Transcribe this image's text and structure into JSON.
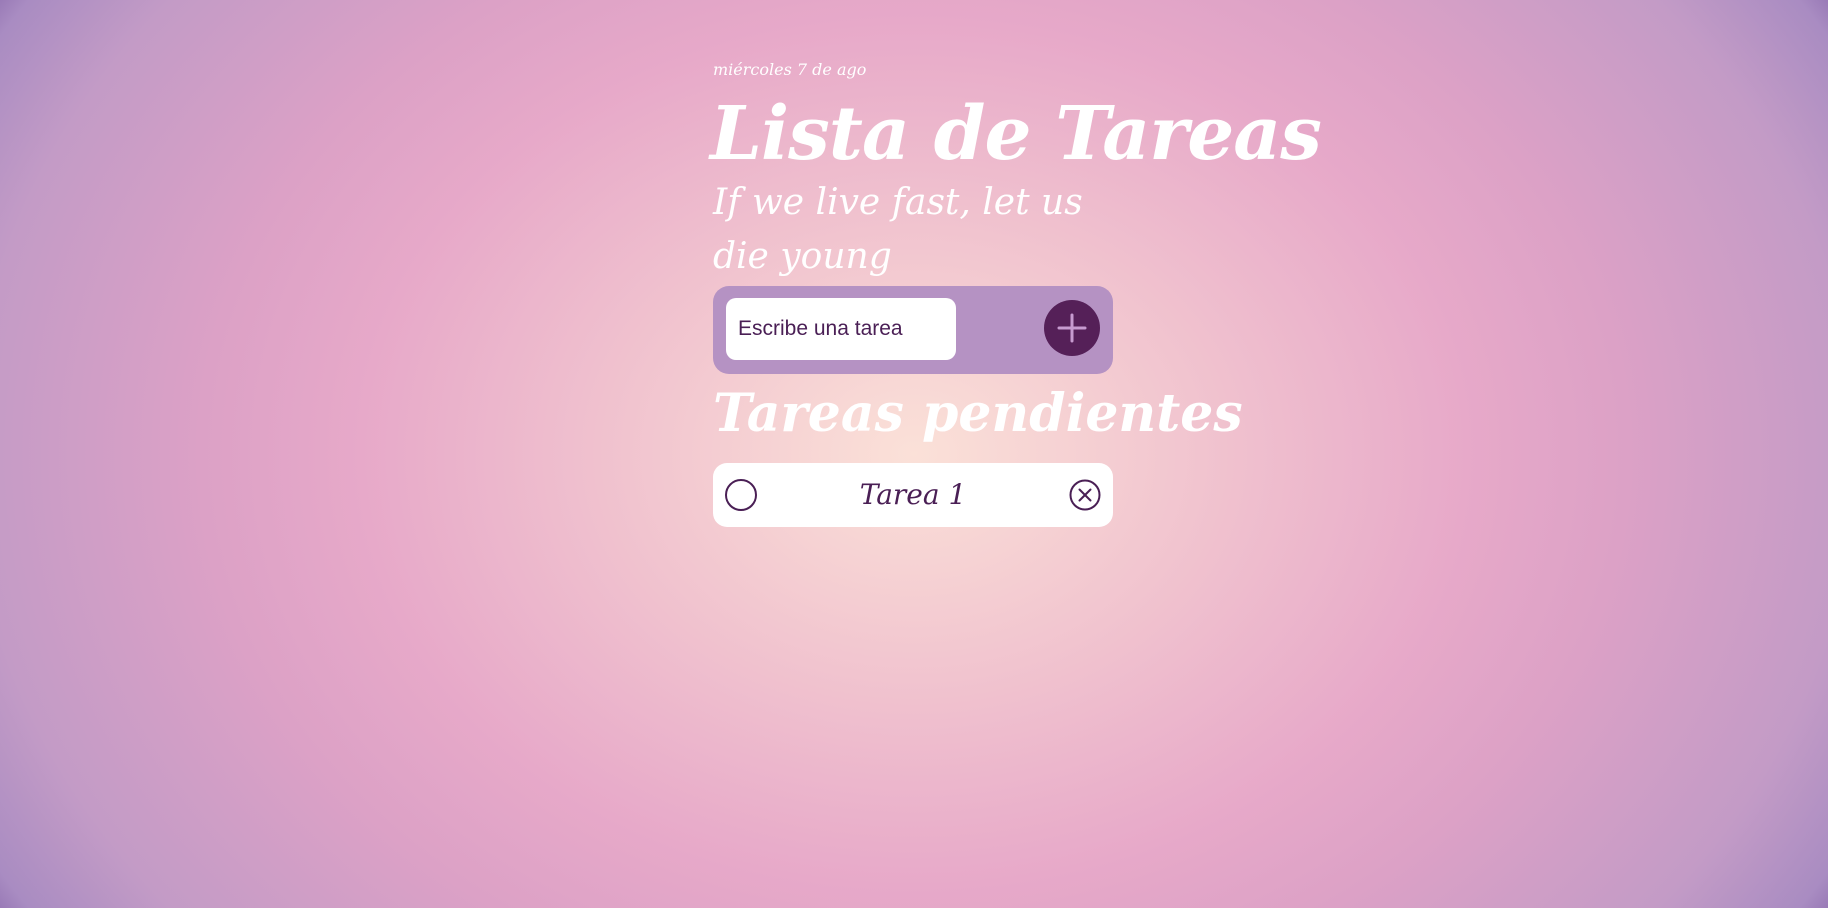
{
  "header": {
    "date": "miércoles 7 de ago",
    "title": "Lista de Tareas",
    "motto": "If we live fast, let us die young"
  },
  "add_task": {
    "placeholder": "Escribe una tarea",
    "button_icon": "plus-icon"
  },
  "pending": {
    "heading": "Tareas pendientes",
    "tasks": [
      {
        "text": "Tarea 1",
        "check_icon": "circle-icon",
        "delete_icon": "close-circle-icon"
      }
    ]
  },
  "colors": {
    "accent": "#552058",
    "panel": "#b592c3",
    "text_dark": "#4a1f55",
    "background_center": "#fbe1d8",
    "background_edge": "#6e4a98"
  }
}
